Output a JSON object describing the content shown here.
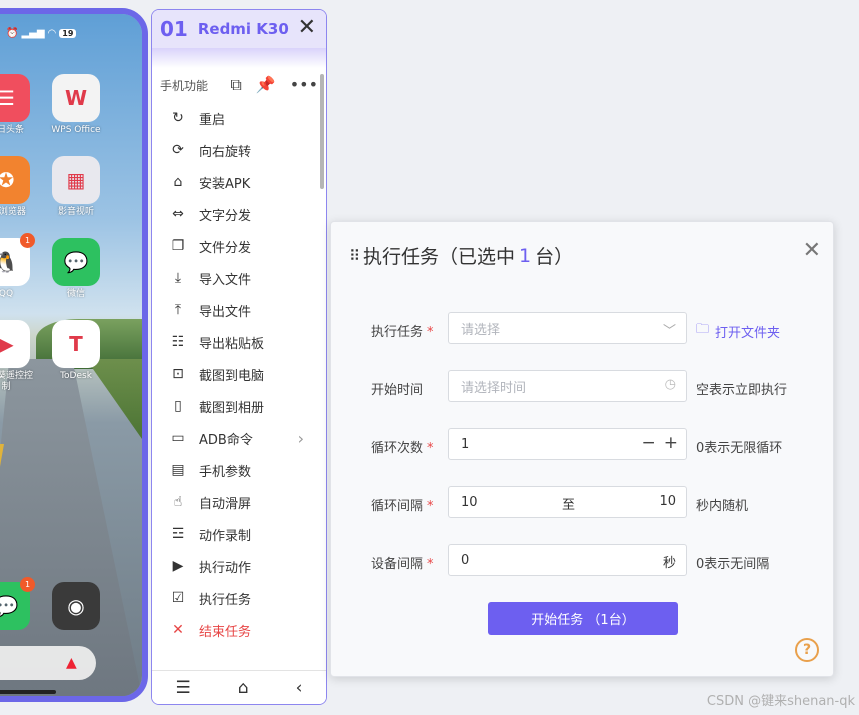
{
  "phone": {
    "status": {
      "battery": "19"
    },
    "apps": [
      {
        "label": "今日头条",
        "color": "#f04e5e",
        "glyph": "☰"
      },
      {
        "label": "WPS Office",
        "color": "#f3f3f3",
        "glyph": "W"
      },
      {
        "label": "UC浏览器",
        "color": "#f2832f",
        "glyph": "✪"
      },
      {
        "label": "影音视听",
        "color": "#e8e8ee",
        "glyph": "▦"
      },
      {
        "label": "QQ",
        "color": "#ffffff",
        "glyph": "🐧",
        "badge": "1"
      },
      {
        "label": "微信",
        "color": "#2dc160",
        "glyph": "💬"
      },
      {
        "label": "向日葵遥控控制",
        "color": "#ffffff",
        "glyph": "▶"
      },
      {
        "label": "ToDesk",
        "color": "#ffffff",
        "glyph": "T"
      },
      {
        "label": "",
        "color": "#2dc160",
        "glyph": "💬",
        "badge": "1"
      },
      {
        "label": "",
        "color": "#3a3a3a",
        "glyph": "◉"
      }
    ]
  },
  "panel": {
    "device_number": "01",
    "device_name": "Redmi K30",
    "section_label": "手机功能",
    "menu": [
      {
        "label": "重启",
        "icon": "↻"
      },
      {
        "label": "向右旋转",
        "icon": "⟳"
      },
      {
        "label": "安装APK",
        "icon": "⌂"
      },
      {
        "label": "文字分发",
        "icon": "⇔"
      },
      {
        "label": "文件分发",
        "icon": "❐"
      },
      {
        "label": "导入文件",
        "icon": "⤓"
      },
      {
        "label": "导出文件",
        "icon": "⤒"
      },
      {
        "label": "导出粘贴板",
        "icon": "☷"
      },
      {
        "label": "截图到电脑",
        "icon": "⊡"
      },
      {
        "label": "截图到相册",
        "icon": "▯"
      },
      {
        "label": "ADB命令",
        "icon": "▭",
        "has_submenu": true
      },
      {
        "label": "手机参数",
        "icon": "▤"
      },
      {
        "label": "自动滑屏",
        "icon": "☝"
      },
      {
        "label": "动作录制",
        "icon": "☲"
      },
      {
        "label": "执行动作",
        "icon": "▶"
      },
      {
        "label": "执行任务",
        "icon": "☑"
      },
      {
        "label": "结束任务",
        "icon": "✕",
        "danger": true
      }
    ],
    "footer": {
      "menu_icon": "☰",
      "home_icon": "⌂",
      "back_icon": "‹"
    }
  },
  "dialog": {
    "title_prefix": "执行任务（已选中",
    "selected_count": "1",
    "title_suffix": "台）",
    "fields": {
      "task": {
        "label": "执行任务",
        "placeholder": "请选择",
        "action": "打开文件夹"
      },
      "start_time": {
        "label": "开始时间",
        "placeholder": "请选择时间",
        "tip": "空表示立即执行"
      },
      "loop_count": {
        "label": "循环次数",
        "value": "1",
        "tip": "0表示无限循环"
      },
      "loop_interval": {
        "label": "循环间隔",
        "from": "10",
        "sep": "至",
        "to": "10",
        "tip": "秒内随机"
      },
      "device_interval": {
        "label": "设备间隔",
        "value": "0",
        "unit": "秒",
        "tip": "0表示无间隔"
      }
    },
    "start_button": "开始任务 （1台）",
    "help": "?"
  },
  "watermark": "CSDN @键来shenan-qk"
}
